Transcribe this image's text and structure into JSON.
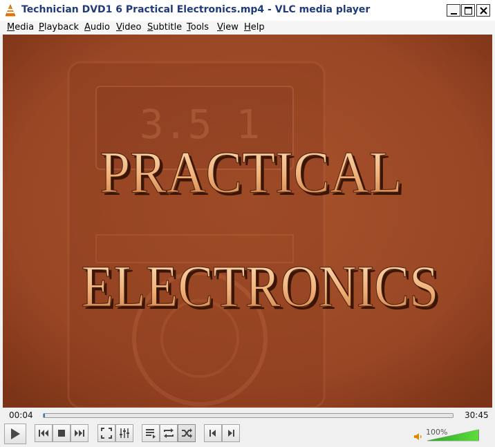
{
  "window": {
    "title": "Technician DVD1 6 Practical Electronics.mp4 - VLC media player"
  },
  "menu": [
    {
      "label": "Media",
      "accel": "M",
      "rest": "edia"
    },
    {
      "label": "Playback",
      "accel": "P",
      "rest": "layback"
    },
    {
      "label": "Audio",
      "accel": "A",
      "rest": "udio"
    },
    {
      "label": "Video",
      "accel": "V",
      "rest": "ideo"
    },
    {
      "label": "Subtitle",
      "accel": "S",
      "rest": "ubtitle"
    },
    {
      "label": "Tools",
      "accel": "T",
      "rest": "ools"
    },
    {
      "label": "View",
      "accel": "V",
      "rest": "iew"
    },
    {
      "label": "Help",
      "accel": "H",
      "rest": "elp"
    }
  ],
  "video": {
    "line1": "PRACTICAL",
    "line2": "ELECTRONICS",
    "meter_reading": "3.5 1"
  },
  "playback": {
    "elapsed": "00:04",
    "total": "30:45",
    "progress_fraction": 0.002
  },
  "volume": {
    "label": "100%",
    "level_fraction": 1.0
  },
  "colors": {
    "accent": "#3a77c2",
    "title_text": "#1f3b7a",
    "video_bg": "#9a4a28",
    "volume_green": "#33cc33"
  }
}
